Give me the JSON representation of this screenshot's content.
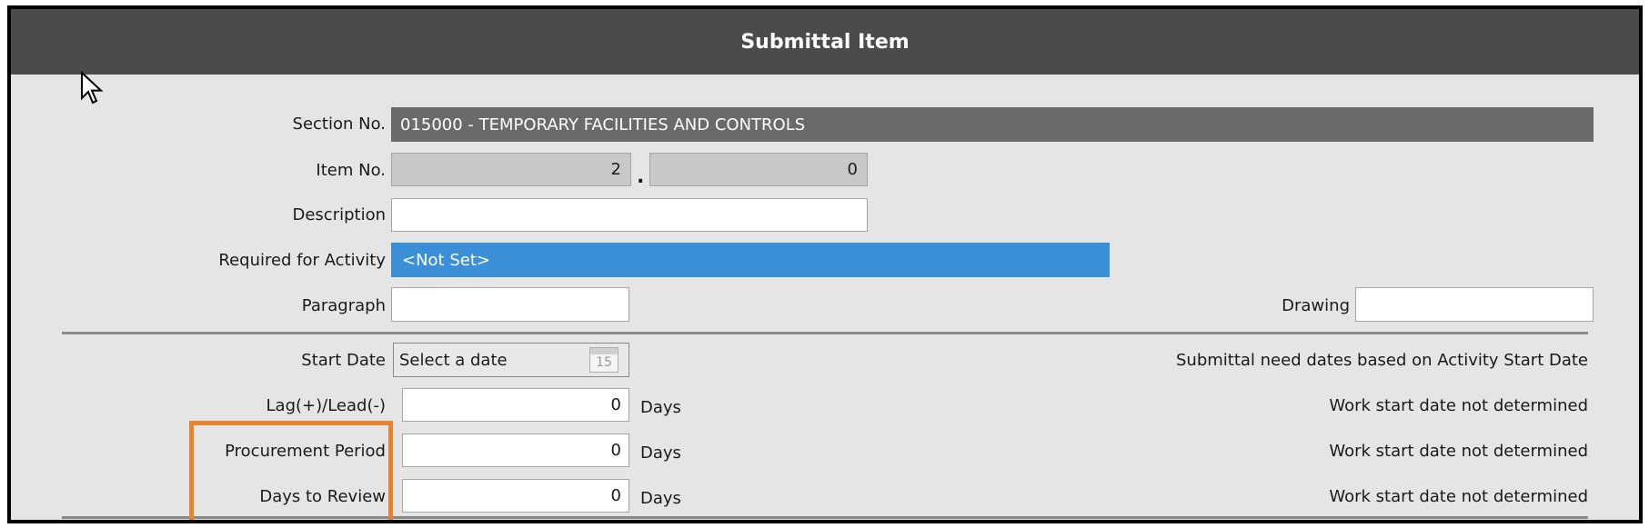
{
  "title": "Submittal Item",
  "section": {
    "label": "Section No.",
    "value": "015000 - TEMPORARY FACILITIES AND CONTROLS"
  },
  "item": {
    "label": "Item No.",
    "value1": "2",
    "separator": ".",
    "value2": "0"
  },
  "description": {
    "label": "Description",
    "value": ""
  },
  "required_activity": {
    "label": "Required for Activity",
    "value": "<Not Set>"
  },
  "paragraph": {
    "label": "Paragraph",
    "value": ""
  },
  "drawing": {
    "label": "Drawing",
    "value": ""
  },
  "start_date": {
    "label": "Start Date",
    "placeholder": "Select a date",
    "calendar_day": "15",
    "note": "Submittal need dates based on Activity Start Date"
  },
  "lag_lead": {
    "label": "Lag(+)/Lead(-)",
    "value": "0",
    "unit": "Days",
    "note": "Work start date not determined"
  },
  "procurement_period": {
    "label": "Procurement Period",
    "value": "0",
    "unit": "Days",
    "note": "Work start date not determined"
  },
  "days_to_review": {
    "label": "Days to Review",
    "value": "0",
    "unit": "Days",
    "note": "Work start date not determined"
  },
  "colors": {
    "title_bar": "#4b4b4b",
    "section_bar": "#6a6a6a",
    "activity_bar": "#3a8fd6",
    "highlight": "#e8822e"
  }
}
